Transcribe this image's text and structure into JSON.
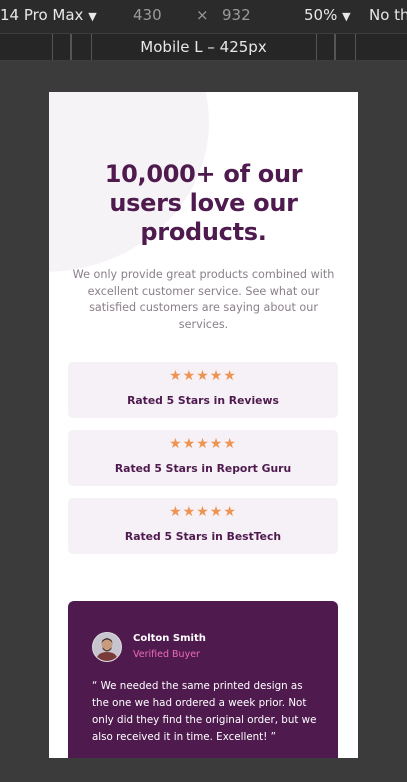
{
  "devtools": {
    "device": "14 Pro Max",
    "width": "430",
    "times": "×",
    "height": "932",
    "zoom": "50%",
    "throttle": "No th",
    "breakpoint_label": "Mobile L – 425px"
  },
  "hero": {
    "title": "10,000+ of our users love our products.",
    "description": "We only provide great products combined with excellent customer service. See what our satisfied customers are saying about our services."
  },
  "ratings": [
    {
      "stars": "★★★★★",
      "label": "Rated 5 Stars in Reviews",
      "value": 5
    },
    {
      "stars": "★★★★★",
      "label": "Rated 5 Stars in Report Guru",
      "value": 5
    },
    {
      "stars": "★★★★★",
      "label": "Rated 5 Stars in BestTech",
      "value": 5
    }
  ],
  "testimonial": {
    "name": "Colton Smith",
    "role": "Verified Buyer",
    "quote": "“ We needed the same printed design as the one we had ordered a week prior. Not only did they find the original order, but we also received it in time. Excellent! ”"
  },
  "colors": {
    "primary": "#4f1b4f",
    "accent_star": "#ee9453",
    "accent_pink": "#ee6bb2",
    "card_bg": "#f6f1f6"
  }
}
